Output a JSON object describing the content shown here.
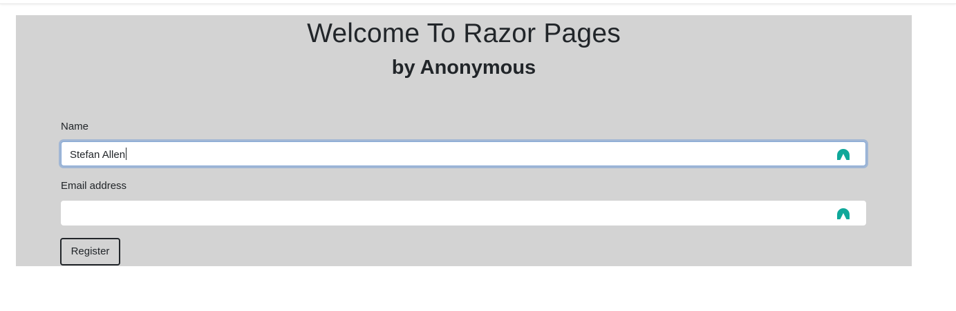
{
  "page": {
    "title": "Welcome To Razor Pages",
    "subtitle": "by Anonymous",
    "panel_color": "#d3d3d3"
  },
  "form": {
    "name": {
      "label": "Name",
      "value": "Stefan Allen",
      "focused": true,
      "icon": "password-manager-icon"
    },
    "email": {
      "label": "Email address",
      "value": "",
      "focused": false,
      "icon": "password-manager-icon"
    },
    "submit_label": "Register"
  },
  "colors": {
    "accent_icon": "#0fa89a",
    "focus_ring": "#86a8d6"
  }
}
